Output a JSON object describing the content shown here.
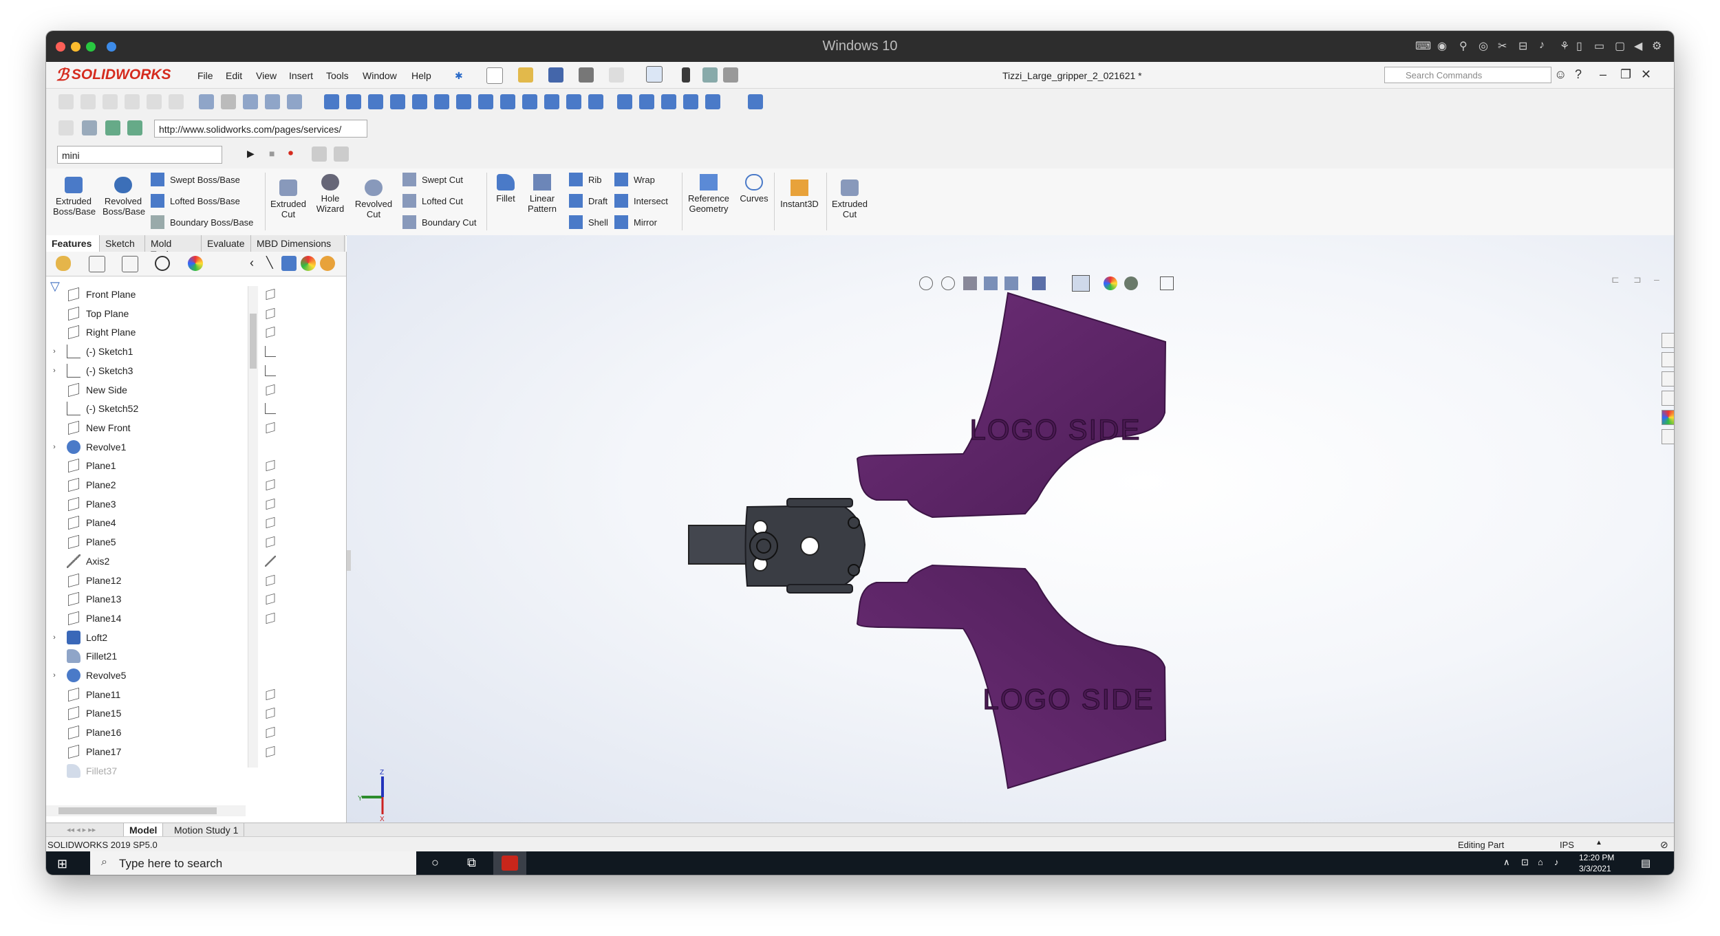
{
  "mac": {
    "title": "Windows 10"
  },
  "solidworks": {
    "logo_text": "SOLIDWORKS",
    "menu": [
      "File",
      "Edit",
      "View",
      "Insert",
      "Tools",
      "Window",
      "Help"
    ],
    "document_title": "Tizzi_Large_gripper_2_021621 *",
    "search_placeholder": "Search Commands"
  },
  "toolbar": {
    "url": "http://www.solidworks.com/pages/services/",
    "config_select": "mini"
  },
  "ribbon": {
    "extruded_boss": "Extruded Boss/Base",
    "revolved_boss": "Revolved Boss/Base",
    "swept_boss": "Swept Boss/Base",
    "lofted_boss": "Lofted Boss/Base",
    "boundary_boss": "Boundary Boss/Base",
    "extruded_cut": "Extruded Cut",
    "hole_wizard": "Hole Wizard",
    "revolved_cut": "Revolved Cut",
    "swept_cut": "Swept Cut",
    "lofted_cut": "Lofted Cut",
    "boundary_cut": "Boundary Cut",
    "fillet": "Fillet",
    "linear_pattern": "Linear Pattern",
    "rib": "Rib",
    "draft": "Draft",
    "shell": "Shell",
    "wrap": "Wrap",
    "intersect": "Intersect",
    "mirror": "Mirror",
    "reference_geometry": "Reference Geometry",
    "curves": "Curves",
    "instant3d": "Instant3D",
    "extruded_cut_2": "Extruded Cut"
  },
  "command_tabs": [
    "Features",
    "Sketch",
    "Mold Tools",
    "Evaluate",
    "MBD Dimensions"
  ],
  "feature_tree": [
    {
      "label": "Front Plane",
      "expandable": false,
      "icon": "plane-icon"
    },
    {
      "label": "Top Plane",
      "expandable": false,
      "icon": "plane-icon"
    },
    {
      "label": "Right Plane",
      "expandable": false,
      "icon": "plane-icon"
    },
    {
      "label": "(-) Sketch1",
      "expandable": true,
      "icon": "sketch-icon"
    },
    {
      "label": "(-) Sketch3",
      "expandable": true,
      "icon": "sketch-icon"
    },
    {
      "label": "New Side",
      "expandable": false,
      "icon": "plane-icon"
    },
    {
      "label": "(-) Sketch52",
      "expandable": false,
      "icon": "sketch-icon"
    },
    {
      "label": "New Front",
      "expandable": false,
      "icon": "plane-icon"
    },
    {
      "label": "Revolve1",
      "expandable": true,
      "icon": "revolve-icon"
    },
    {
      "label": "Plane1",
      "expandable": false,
      "icon": "plane-icon"
    },
    {
      "label": "Plane2",
      "expandable": false,
      "icon": "plane-icon"
    },
    {
      "label": "Plane3",
      "expandable": false,
      "icon": "plane-icon"
    },
    {
      "label": "Plane4",
      "expandable": false,
      "icon": "plane-icon"
    },
    {
      "label": "Plane5",
      "expandable": false,
      "icon": "plane-icon"
    },
    {
      "label": "Axis2",
      "expandable": false,
      "icon": "axis-icon"
    },
    {
      "label": "Plane12",
      "expandable": false,
      "icon": "plane-icon"
    },
    {
      "label": "Plane13",
      "expandable": false,
      "icon": "plane-icon"
    },
    {
      "label": "Plane14",
      "expandable": false,
      "icon": "plane-icon"
    },
    {
      "label": "Loft2",
      "expandable": true,
      "icon": "loft-icon"
    },
    {
      "label": "Fillet21",
      "expandable": false,
      "icon": "fillet-icon"
    },
    {
      "label": "Revolve5",
      "expandable": true,
      "icon": "revolve-icon"
    },
    {
      "label": "Plane11",
      "expandable": false,
      "icon": "plane-icon"
    },
    {
      "label": "Plane15",
      "expandable": false,
      "icon": "plane-icon"
    },
    {
      "label": "Plane16",
      "expandable": false,
      "icon": "plane-icon"
    },
    {
      "label": "Plane17",
      "expandable": false,
      "icon": "plane-icon"
    },
    {
      "label": "Fillet37",
      "expandable": false,
      "icon": "fillet-icon",
      "suppressed": true
    }
  ],
  "model_tabs": [
    "Model",
    "Motion Study 1"
  ],
  "status": {
    "version": "SOLIDWORKS 2019 SP5.0",
    "mode": "Editing Part",
    "units": "IPS"
  },
  "model": {
    "engraving_top": "LOGO SIDE",
    "engraving_bottom": "LOGO SIDE",
    "finger_color": "#5b2464",
    "body_color": "#3a3d44"
  },
  "taskbar": {
    "search_placeholder": "Type here to search",
    "time": "12:20 PM",
    "date": "3/3/2021"
  },
  "colors": {
    "brand": "#d52b1e",
    "mac_titlebar": "#2d2d2d",
    "taskbar": "#101820"
  }
}
